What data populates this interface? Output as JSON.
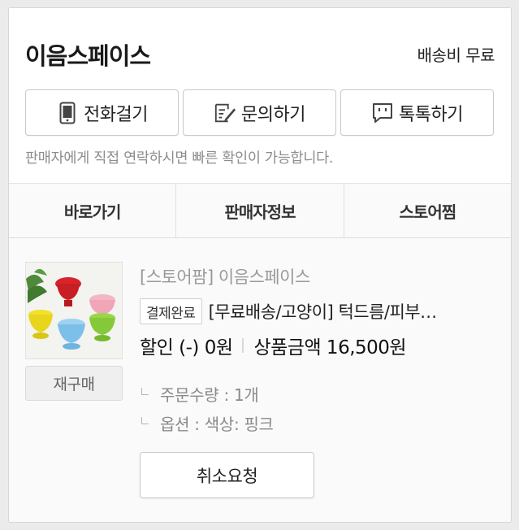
{
  "store": {
    "name": "이음스페이스",
    "shipping_label": "배송비 무료"
  },
  "contact": {
    "buttons": [
      {
        "label": "전화걸기",
        "icon": "phone-icon"
      },
      {
        "label": "문의하기",
        "icon": "inquiry-edit-icon"
      },
      {
        "label": "톡톡하기",
        "icon": "talk-chat-icon"
      }
    ],
    "notice": "판매자에게 직접 연락하시면 빠른 확인이 가능합니다."
  },
  "tabs": [
    {
      "label": "바로가기"
    },
    {
      "label": "판매자정보"
    },
    {
      "label": "스토어찜"
    }
  ],
  "order": {
    "store_link": "[스토어팜] 이음스페이스",
    "status_badge": "결제완료",
    "product_title": "[무료배송/고양이] 턱드름/피부…",
    "discount": "할인 (-) 0원",
    "amount": "상품금액 16,500원",
    "options": [
      "주문수량 : 1개",
      "옵션 : 색상: 핑크"
    ],
    "rebuy_label": "재구매",
    "cancel_label": "취소요청",
    "product_image_icon": "cat-bowls-product-image"
  },
  "colors": {
    "border": "#c9c9c9",
    "muted_text": "#8c8c8c",
    "section_bg": "#fafafa",
    "page_bg": "#ebebeb"
  }
}
